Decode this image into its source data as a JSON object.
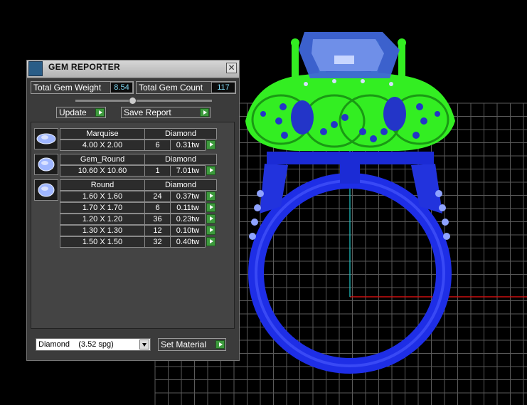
{
  "panel": {
    "title": "GEM REPORTER",
    "close_glyph": "✕",
    "total_weight_label": "Total Gem Weight",
    "total_weight_value": "8.54",
    "total_count_label": "Total Gem Count",
    "total_count_value": "117",
    "update_label": "Update",
    "save_report_label": "Save Report",
    "material_select_value": "Diamond    (3.52 spg)",
    "set_material_label": "Set Material"
  },
  "groups": [
    {
      "icon": "marquise-gem-icon",
      "shape": "Marquise",
      "material": "Diamond",
      "rows": [
        {
          "size": "4.00 X 2.00",
          "count": "6",
          "weight": "0.31tw"
        }
      ]
    },
    {
      "icon": "round-gem-icon",
      "shape": "Gem_Round",
      "material": "Diamond",
      "rows": [
        {
          "size": "10.60 X 10.60",
          "count": "1",
          "weight": "7.01tw"
        }
      ]
    },
    {
      "icon": "round-gem-icon",
      "shape": "Round",
      "material": "Diamond",
      "rows": [
        {
          "size": "1.60 X 1.60",
          "count": "24",
          "weight": "0.37tw"
        },
        {
          "size": "1.70 X 1.70",
          "count": "6",
          "weight": "0.11tw"
        },
        {
          "size": "1.20 X 1.20",
          "count": "36",
          "weight": "0.23tw"
        },
        {
          "size": "1.30 X 1.30",
          "count": "12",
          "weight": "0.10tw"
        },
        {
          "size": "1.50 X 1.50",
          "count": "32",
          "weight": "0.40tw"
        }
      ]
    }
  ],
  "colors": {
    "ring_band": "#1e2ee6",
    "ring_head": "#33ee22",
    "center_stone": "#3f66d8",
    "grid_line": "#5a5a5a",
    "axis_red": "#cc1111",
    "axis_cyan": "#22cccc"
  }
}
